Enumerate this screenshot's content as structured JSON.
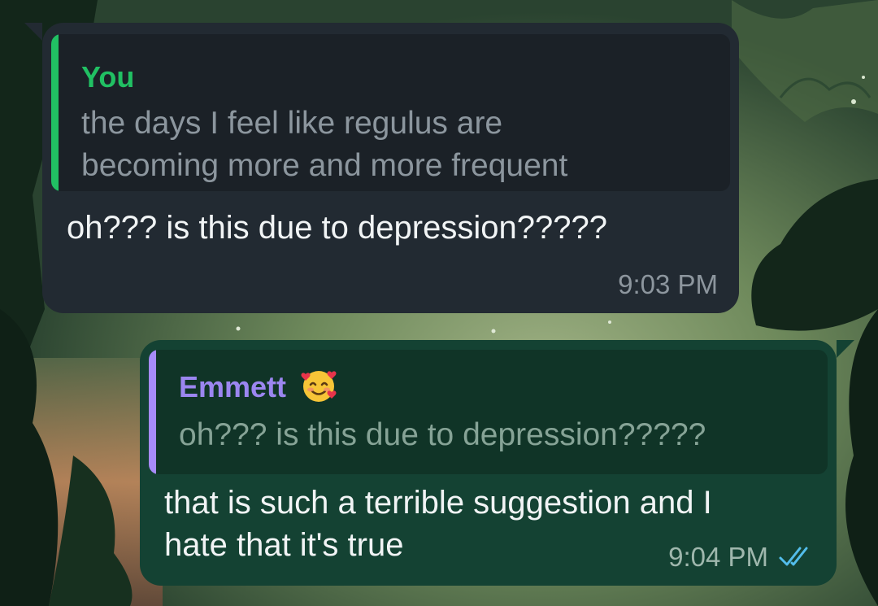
{
  "messages": [
    {
      "direction": "incoming",
      "reply_to": {
        "author": "You",
        "text": "the days I feel like regulus are\nbecoming more and more frequent"
      },
      "text": "oh??? is this due to depression?????",
      "time": "9:03 PM"
    },
    {
      "direction": "outgoing",
      "reply_to": {
        "author": "Emmett",
        "author_emoji": "smiling-face-with-hearts",
        "text": "oh??? is this due to depression?????"
      },
      "text": "that is such a terrible suggestion and I\nhate that it's true",
      "time": "9:04 PM",
      "status": "read",
      "status_icon": "double-check-icon"
    }
  ],
  "colors": {
    "incoming_bubble": "#222a32",
    "outgoing_bubble": "#144233",
    "you_accent": "#21c063",
    "emmett_accent": "#9b86f0",
    "read_ticks": "#53bdeb"
  }
}
